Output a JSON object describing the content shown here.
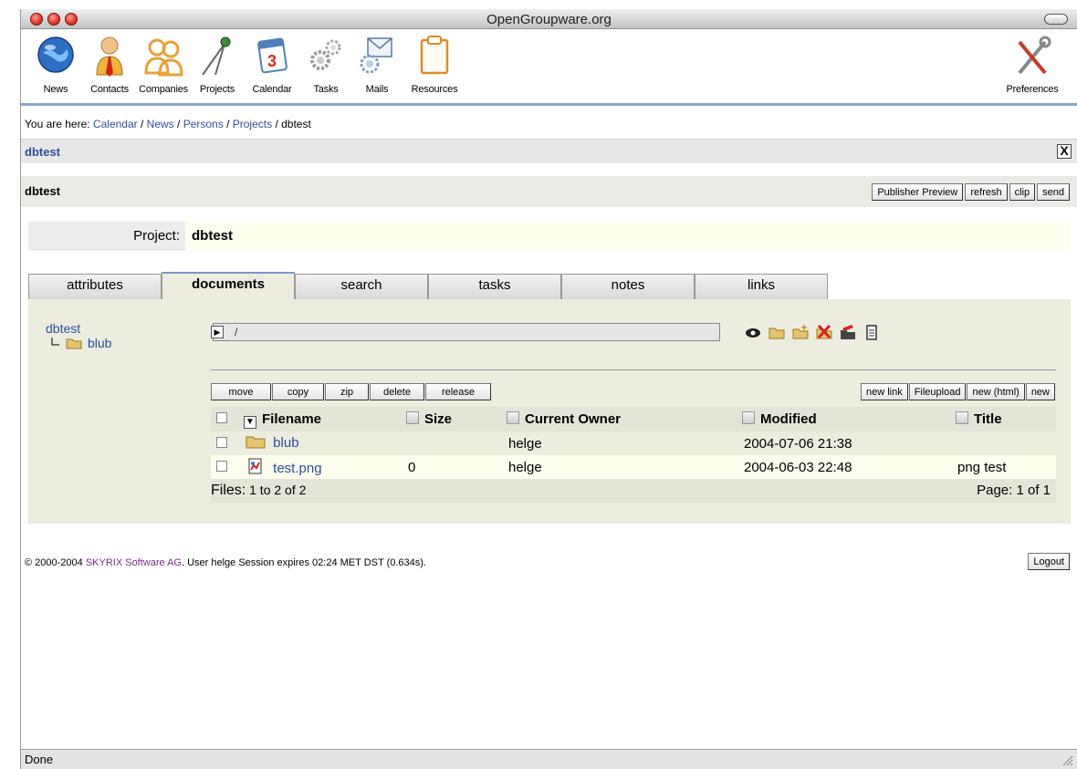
{
  "window": {
    "title": "OpenGroupware.org"
  },
  "toolbar": {
    "items": [
      {
        "label": "News",
        "icon": "globe-icon"
      },
      {
        "label": "Contacts",
        "icon": "person-icon"
      },
      {
        "label": "Companies",
        "icon": "people-icon"
      },
      {
        "label": "Projects",
        "icon": "compass-icon"
      },
      {
        "label": "Calendar",
        "icon": "calendar-icon"
      },
      {
        "label": "Tasks",
        "icon": "gears-icon"
      },
      {
        "label": "Mails",
        "icon": "mail-icon"
      },
      {
        "label": "Resources",
        "icon": "clipboard-icon"
      },
      {
        "label": "Preferences",
        "icon": "tools-icon"
      }
    ]
  },
  "breadcrumb": {
    "prefix": "You are here: ",
    "links": [
      "Calendar",
      "News",
      "Persons",
      "Projects"
    ],
    "sep": " / ",
    "current": "dbtest"
  },
  "panel": {
    "title": "dbtest",
    "close": "X"
  },
  "header": {
    "title": "dbtest",
    "buttons": [
      "Publisher Preview",
      "refresh",
      "clip",
      "send"
    ]
  },
  "project": {
    "label": "Project:",
    "value": "dbtest"
  },
  "tabs": [
    "attributes",
    "documents",
    "search",
    "tasks",
    "notes",
    "links"
  ],
  "active_tab": "documents",
  "tree": {
    "root": "dbtest",
    "child": "blub"
  },
  "path": {
    "value": "/"
  },
  "actions": {
    "left": [
      "move",
      "copy",
      "zip",
      "delete",
      "release"
    ],
    "right": [
      "new link",
      "Fileupload",
      "new (html)",
      "new"
    ]
  },
  "table": {
    "columns": [
      "Filename",
      "Size",
      "Current Owner",
      "Modified",
      "Title"
    ],
    "rows": [
      {
        "name": "blub",
        "type": "folder",
        "size": "",
        "owner": "helge",
        "modified": "2004-07-06 21:38",
        "title": ""
      },
      {
        "name": "test.png",
        "type": "image",
        "size": "0",
        "owner": "helge",
        "modified": "2004-06-03 22:48",
        "title": "png test"
      }
    ],
    "files_label": "Files:",
    "files_range": " 1 to 2 of 2",
    "page": "Page: 1 of 1"
  },
  "footer": {
    "copyright": "© 2000-2004 ",
    "company": "SKYRIX Software AG",
    "rest": ". User helge Session expires 02:24 MET DST (0.634s).",
    "logout": "Logout"
  },
  "status": {
    "text": "Done"
  }
}
